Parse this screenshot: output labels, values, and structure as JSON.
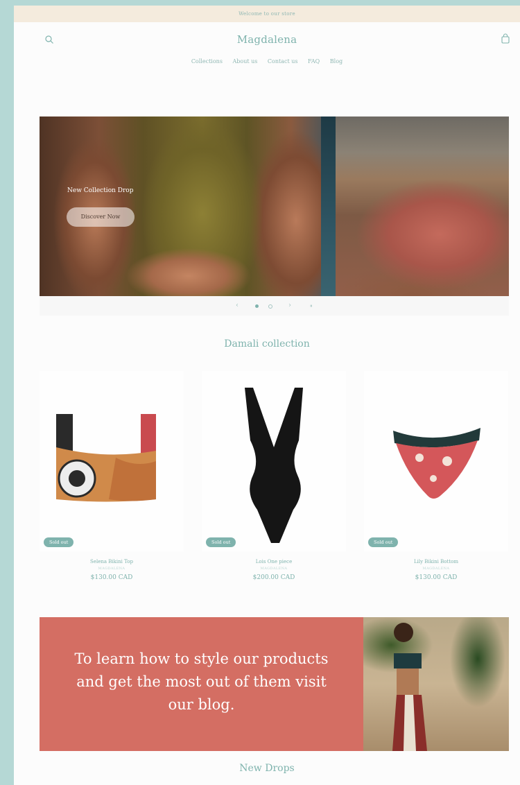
{
  "announcement": "Welcome to our store",
  "header": {
    "logo": "Magdalena",
    "search_icon": "search-icon",
    "cart_icon": "shopping-bag-icon",
    "nav": [
      "Collections",
      "About us",
      "Contact us",
      "FAQ",
      "Blog"
    ]
  },
  "hero": {
    "title": "New Collection Drop",
    "button_label": "Discover Now",
    "controls": {
      "prev": "‹",
      "next": "›",
      "pause": "⏸",
      "slide_count": 2,
      "active_slide": 1
    }
  },
  "collection": {
    "title": "Damali collection",
    "products": [
      {
        "name": "Selena Bikini Top",
        "vendor": "MAGDALENA",
        "price": "$130.00 CAD",
        "badge": "Sold out"
      },
      {
        "name": "Lois One piece",
        "vendor": "MAGDALENA",
        "price": "$200.00 CAD",
        "badge": "Sold out"
      },
      {
        "name": "Lily Bikini Bottom",
        "vendor": "MAGDALENA",
        "price": "$130.00 CAD",
        "badge": "Sold out"
      }
    ]
  },
  "blog_banner": {
    "text": "To learn how to style our products and get the most out of them visit our blog."
  },
  "new_drops": {
    "title": "New Drops"
  },
  "colors": {
    "accent": "#7fb3ad",
    "announcement_bg": "#f4ebdd",
    "banner_bg": "#d46e63",
    "outer_bg": "#b5d8d5"
  }
}
